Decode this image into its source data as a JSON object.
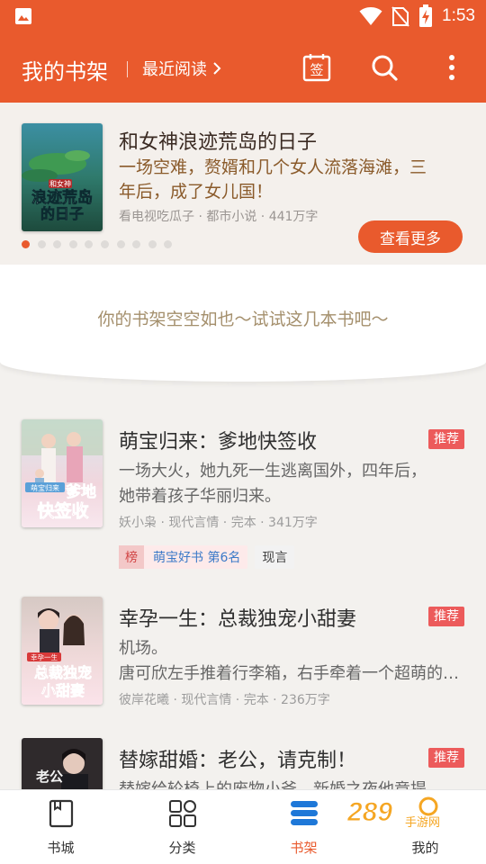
{
  "status_bar": {
    "time": "1:53"
  },
  "appbar": {
    "title": "我的书架",
    "recent_label": "最近阅读"
  },
  "featured": {
    "title": "和女神浪迹荒岛的日子",
    "desc_line1": "一场空难，赘婿和几个女人流落海滩，三",
    "desc_line2": "年后，成了女儿国！",
    "meta": "看电视吃瓜子 · 都市小说 · 441万字",
    "more_button": "查看更多",
    "cover_text_top": "和女神",
    "cover_text_main": "浪迹荒岛",
    "cover_text_sub": "的日子",
    "pages": 10,
    "active_page": 0
  },
  "empty_message": "你的书架空空如也～试试这几本书吧～",
  "books": [
    {
      "title": "萌宝归来：爹地快签收",
      "badge": "推荐",
      "desc_line1": "一场大火，她九死一生逃离国外，四年后，",
      "desc_line2": "她带着孩子华丽归来。",
      "meta": "妖小枭 · 现代言情 · 完本 · 341万字",
      "rank_tag_icon": "榜",
      "rank_tag": "萌宝好书 第6名",
      "genre_tag": "现言",
      "cover_text_a": "萌宝归来",
      "cover_text_b": "爹地",
      "cover_text_c": "快签收"
    },
    {
      "title": "幸孕一生：总裁独宠小甜妻",
      "badge": "推荐",
      "desc_line1": "机场。",
      "desc_line2": "唐可欣左手推着行李箱，右手牵着一个超萌的孩子",
      "meta": "彼岸花曦 · 现代言情 · 完本 · 236万字",
      "cover_text_a": "幸孕一生",
      "cover_text_b": "总裁独宠",
      "cover_text_c": "小甜妻"
    },
    {
      "title": "替嫁甜婚：老公，请克制！",
      "badge": "推荐",
      "desc_line1": "替嫁给轮椅上的废物小爷，新婚之夜他竟提",
      "cover_text_a": "老公"
    }
  ],
  "bottom_nav": [
    {
      "label": "书城",
      "icon": "book-icon"
    },
    {
      "label": "分类",
      "icon": "grid-icon"
    },
    {
      "label": "书架",
      "icon": "shelf-icon"
    },
    {
      "label": "我的",
      "icon": "person-icon"
    }
  ],
  "watermark": {
    "text_big": "289",
    "text_small": "手游网"
  },
  "colors": {
    "accent": "#e95a2d",
    "badge": "#ec5b5b",
    "empty_text": "#a48f6c",
    "rank_blue": "#3c7ac8"
  }
}
